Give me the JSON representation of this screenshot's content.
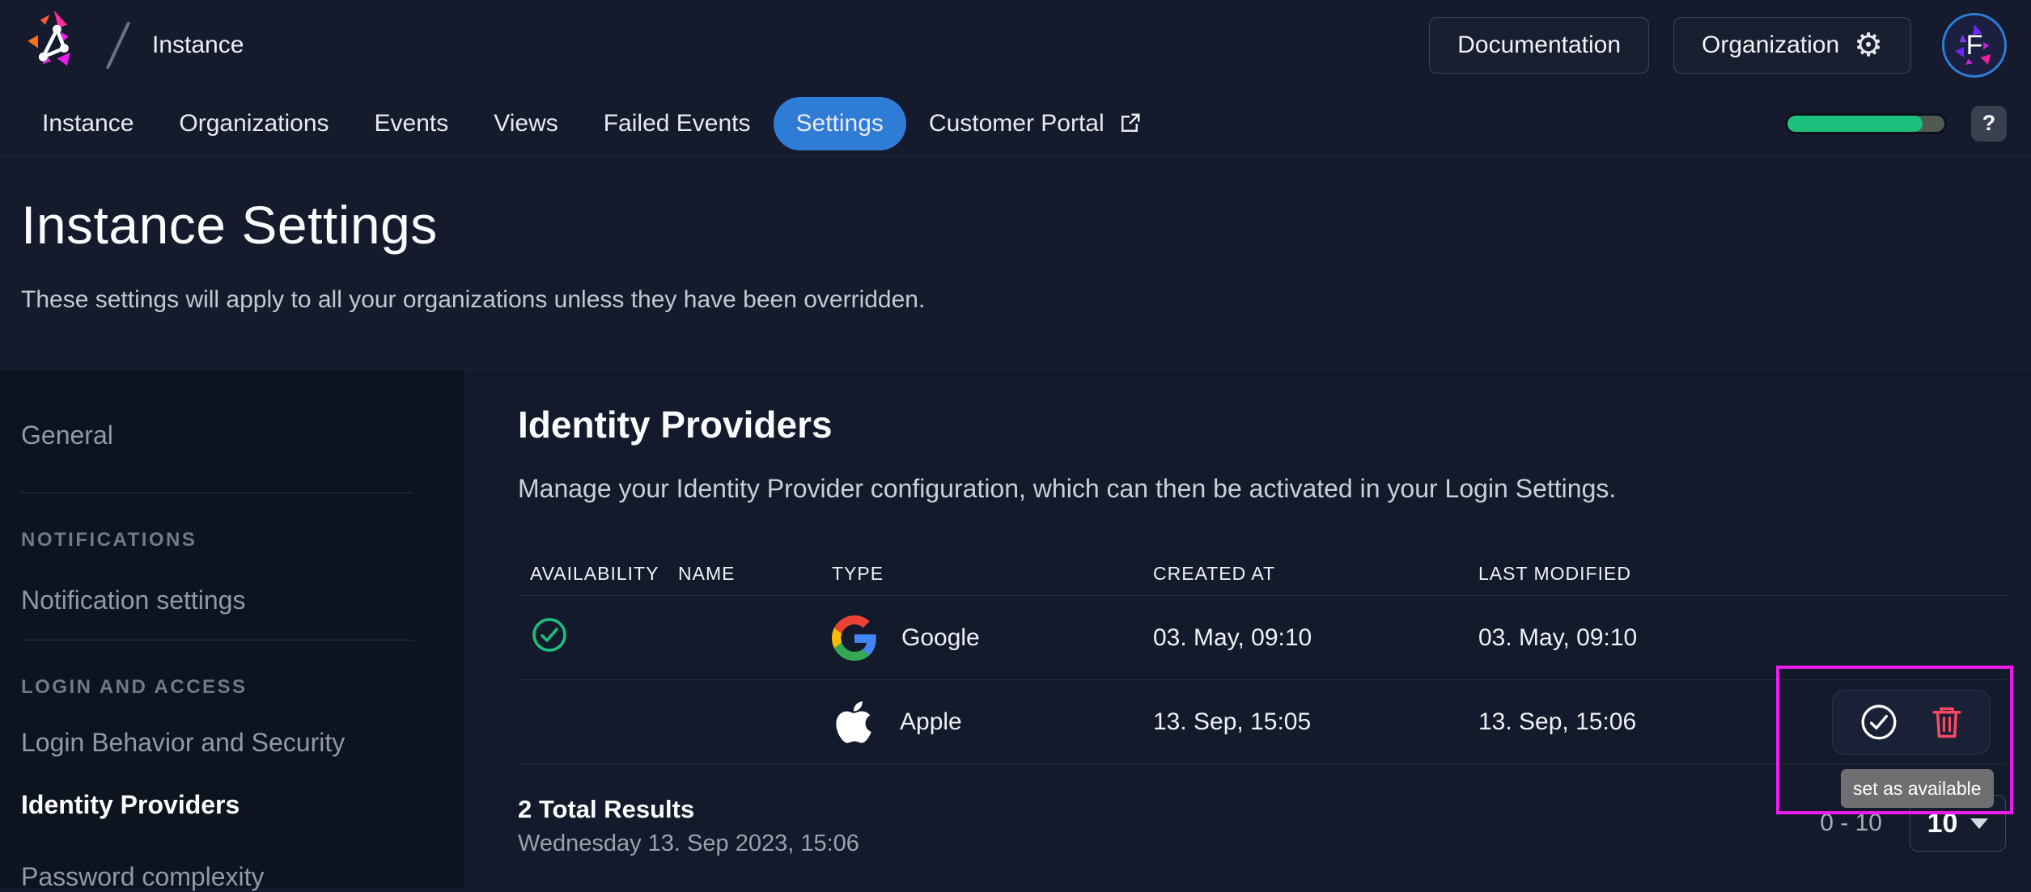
{
  "header": {
    "breadcrumb": "Instance",
    "documentation_label": "Documentation",
    "organization_label": "Organization",
    "avatar_letter": "F"
  },
  "tabs": {
    "items": [
      "Instance",
      "Organizations",
      "Events",
      "Views",
      "Failed Events",
      "Settings",
      "Customer Portal"
    ],
    "active": "Settings",
    "help_label": "?"
  },
  "usage": {
    "fill_style": "width:86%"
  },
  "page": {
    "title": "Instance Settings",
    "subtitle": "These settings will apply to all your organizations unless they have been overridden."
  },
  "sidebar": {
    "general": "General",
    "groups": [
      {
        "label": "NOTIFICATIONS",
        "items": [
          "Notification settings"
        ]
      },
      {
        "label": "LOGIN AND ACCESS",
        "items": [
          "Login Behavior and Security",
          "Identity Providers",
          "Password complexity"
        ]
      }
    ],
    "active_item": "Identity Providers"
  },
  "main": {
    "heading": "Identity Providers",
    "description": "Manage your Identity Provider configuration, which can then be activated in your Login Settings.",
    "table": {
      "columns": [
        "AVAILABILITY",
        "NAME",
        "TYPE",
        "CREATED AT",
        "LAST MODIFIED"
      ],
      "rows": [
        {
          "available": true,
          "name": "",
          "type": "Google",
          "created_at": "03. May, 09:10",
          "last_modified": "03. May, 09:10"
        },
        {
          "available": false,
          "name": "",
          "type": "Apple",
          "created_at": "13. Sep, 15:05",
          "last_modified": "13. Sep, 15:06"
        }
      ]
    },
    "footer": {
      "total": "2 Total Results",
      "timestamp": "Wednesday 13. Sep 2023, 15:06",
      "range": "0 - 10",
      "page_size": "10"
    },
    "tooltip": "set as available"
  },
  "colors": {
    "accent_blue": "#2e7cd6",
    "success_green": "#1dbf7c",
    "danger_red": "#fb4960",
    "annotation_magenta": "#ec1dec",
    "tooltip_gray": "#6f6f71"
  }
}
